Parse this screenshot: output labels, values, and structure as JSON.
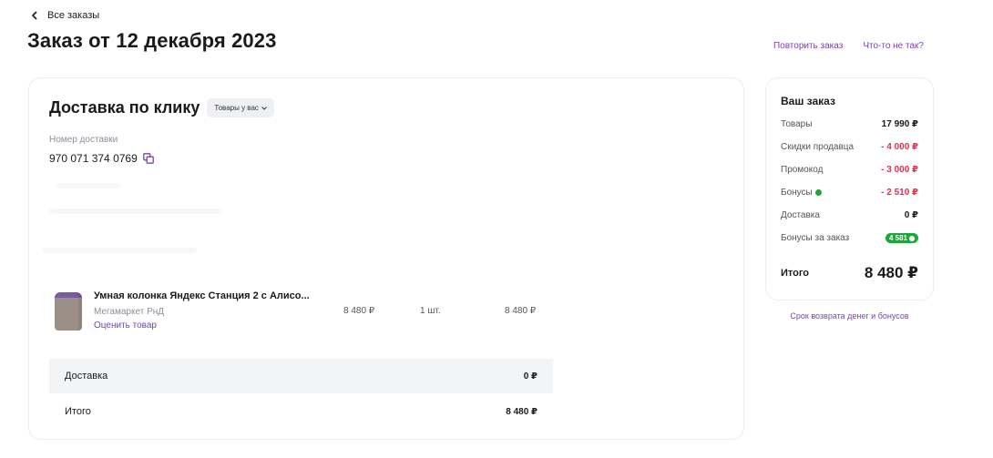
{
  "nav": {
    "back_label": "Все заказы"
  },
  "page": {
    "title": "Заказ от 12 декабря 2023"
  },
  "header_links": {
    "repeat": "Повторить заказ",
    "problem": "Что-то не так?"
  },
  "delivery": {
    "title": "Доставка по клику",
    "badge": "Товары у вас",
    "number_label": "Номер доставки",
    "number": "970 071 374 0769"
  },
  "product": {
    "name": "Умная колонка Яндекс Станция 2 с Алисо...",
    "seller": "Мегамаркет РнД",
    "rate_label": "Оценить товар",
    "price": "8 480 ₽",
    "quantity": "1 шт.",
    "total": "8 480 ₽"
  },
  "delivery_summary": {
    "delivery_label": "Доставка",
    "delivery_value": "0 ₽",
    "total_label": "Итого",
    "total_value": "8 480 ₽"
  },
  "order_summary": {
    "title": "Ваш заказ",
    "rows": [
      {
        "label": "Товары",
        "value": "17 990 ₽",
        "color": "#1a1a1a"
      },
      {
        "label": "Скидки продавца",
        "value": "- 4 000 ₽",
        "color": "#e0304e"
      },
      {
        "label": "Промокод",
        "value": "- 3 000 ₽",
        "color": "#e0304e"
      },
      {
        "label": "Бонусы",
        "value": "- 2 510 ₽",
        "color": "#e0304e"
      },
      {
        "label": "Доставка",
        "value": "0 ₽",
        "color": "#1a1a1a"
      },
      {
        "label": "Бонусы за заказ",
        "value": "4 581",
        "color": "#1ea63b"
      }
    ],
    "total_label": "Итого",
    "total_value": "8 480 ₽"
  },
  "refund_link": "Срок возврата денег и бонусов",
  "colors": {
    "accent": "#7b3fb5",
    "discount": "#e0304e",
    "bonus": "#1ea63b"
  }
}
